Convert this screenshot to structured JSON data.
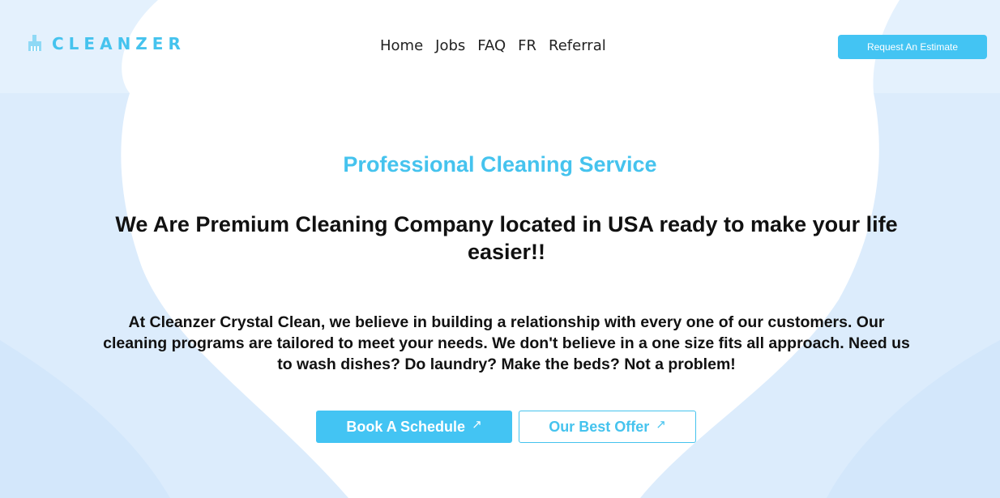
{
  "brand": {
    "name": "CLEANZER",
    "icon": "cleaning-bucket-icon",
    "color": "#45c3ee"
  },
  "nav": {
    "items": [
      "Home",
      "Jobs",
      "FAQ",
      "FR",
      "Referral"
    ]
  },
  "header": {
    "cta_label": "Request An Estimate"
  },
  "hero": {
    "subtitle": "Professional Cleaning Service",
    "title": "We Are Premium Cleaning Company located in USA ready to make your life easier!!",
    "description": "At Cleanzer Crystal Clean, we believe in building a relationship with every one of our customers. Our cleaning programs are tailored to meet your needs. We don't believe in a one size fits all approach. Need us to wash dishes? Do laundry? Make the beds? Not a problem!",
    "primary_cta": {
      "label": "Book A Schedule",
      "icon": "arrow-up-right-icon",
      "glyph": "↗"
    },
    "secondary_cta": {
      "label": "Our Best Offer",
      "icon": "arrow-up-right-icon",
      "glyph": "↗"
    }
  },
  "colors": {
    "accent": "#45c3ee",
    "background_wave": "#dbeeff"
  }
}
